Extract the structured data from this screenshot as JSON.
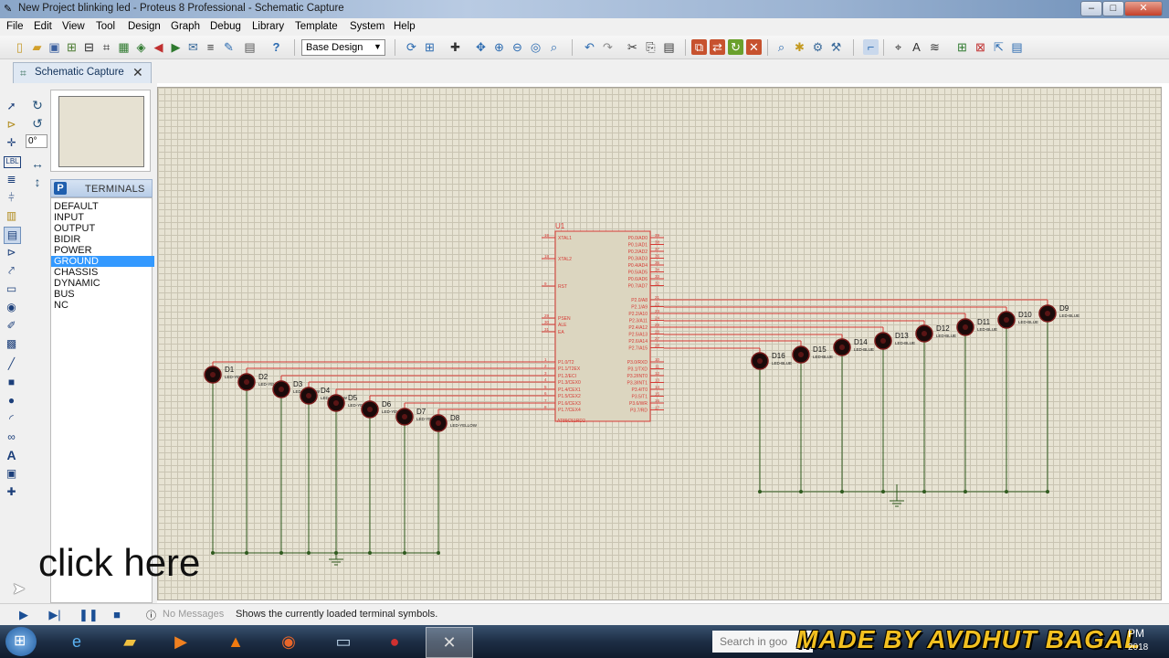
{
  "window": {
    "title": "New Project blinking led - Proteus 8 Professional - Schematic Capture",
    "controls": [
      "–",
      "□",
      "✕"
    ]
  },
  "menu": [
    "File",
    "Edit",
    "View",
    "Tool",
    "Design",
    "Graph",
    "Debug",
    "Library",
    "Template",
    "System",
    "Help"
  ],
  "toolbar": {
    "variant_select": "Base Design"
  },
  "tab": {
    "label": "Schematic Capture"
  },
  "side": {
    "angle": "0°",
    "terminals_title": "TERMINALS",
    "terminals_badge": "P",
    "terminals": [
      "DEFAULT",
      "INPUT",
      "OUTPUT",
      "BIDIR",
      "POWER",
      "GROUND",
      "CHASSIS",
      "DYNAMIC",
      "BUS",
      "NC"
    ],
    "selected_terminal": "GROUND"
  },
  "schematic": {
    "mcu_ref": "U1",
    "mcu_part": "AT89C51RD2",
    "mcu_left_pins": [
      {
        "num": "19",
        "name": "XTAL1"
      },
      {
        "num": "18",
        "name": "XTAL2"
      },
      {
        "num": "9",
        "name": "RST"
      },
      {
        "num": "29",
        "name": "PSEN"
      },
      {
        "num": "30",
        "name": "ALE"
      },
      {
        "num": "31",
        "name": "EA"
      },
      {
        "num": "1",
        "name": "P1.0/T2"
      },
      {
        "num": "2",
        "name": "P1.1/T2EX"
      },
      {
        "num": "3",
        "name": "P1.2/ECI"
      },
      {
        "num": "4",
        "name": "P1.3/CEX0"
      },
      {
        "num": "5",
        "name": "P1.4/CEX1"
      },
      {
        "num": "6",
        "name": "P1.5/CEX2"
      },
      {
        "num": "7",
        "name": "P1.6/CEX3"
      },
      {
        "num": "8",
        "name": "P1.7/CEX4"
      }
    ],
    "mcu_right_pins": [
      {
        "num": "39",
        "name": "P0.0/AD0"
      },
      {
        "num": "38",
        "name": "P0.1/AD1"
      },
      {
        "num": "37",
        "name": "P0.2/AD2"
      },
      {
        "num": "36",
        "name": "P0.3/AD3"
      },
      {
        "num": "35",
        "name": "P0.4/AD4"
      },
      {
        "num": "34",
        "name": "P0.5/AD5"
      },
      {
        "num": "33",
        "name": "P0.6/AD6"
      },
      {
        "num": "32",
        "name": "P0.7/AD7"
      },
      {
        "num": "21",
        "name": "P2.0/A8"
      },
      {
        "num": "22",
        "name": "P2.1/A9"
      },
      {
        "num": "23",
        "name": "P2.2/A10"
      },
      {
        "num": "24",
        "name": "P2.3/A11"
      },
      {
        "num": "25",
        "name": "P2.4/A12"
      },
      {
        "num": "26",
        "name": "P2.5/A13"
      },
      {
        "num": "27",
        "name": "P2.6/A14"
      },
      {
        "num": "28",
        "name": "P2.7/A15"
      },
      {
        "num": "10",
        "name": "P3.0/RXD"
      },
      {
        "num": "11",
        "name": "P3.1/TXD"
      },
      {
        "num": "12",
        "name": "P3.2/INT0"
      },
      {
        "num": "13",
        "name": "P3.3/INT1"
      },
      {
        "num": "14",
        "name": "P3.4/T0"
      },
      {
        "num": "15",
        "name": "P3.5/T1"
      },
      {
        "num": "16",
        "name": "P3.6/WR"
      },
      {
        "num": "17",
        "name": "P3.7/RD"
      }
    ],
    "leds_left": [
      {
        "ref": "D1",
        "type": "LED-YELLOW"
      },
      {
        "ref": "D2",
        "type": "LED-YELLOW"
      },
      {
        "ref": "D3",
        "type": "LED-YELLOW"
      },
      {
        "ref": "D4",
        "type": "LED-YELLOW"
      },
      {
        "ref": "D5",
        "type": "LED-YELLOW"
      },
      {
        "ref": "D6",
        "type": "LED-YELLOW"
      },
      {
        "ref": "D7",
        "type": "LED-YELLOW"
      },
      {
        "ref": "D8",
        "type": "LED-YELLOW"
      }
    ],
    "leds_right": [
      {
        "ref": "D9",
        "type": "LED-BLUE"
      },
      {
        "ref": "D10",
        "type": "LED-BLUE"
      },
      {
        "ref": "D11",
        "type": "LED-BLUE"
      },
      {
        "ref": "D12",
        "type": "LED-BLUE"
      },
      {
        "ref": "D13",
        "type": "LED-BLUE"
      },
      {
        "ref": "D14",
        "type": "LED-BLUE"
      },
      {
        "ref": "D15",
        "type": "LED-BLUE"
      },
      {
        "ref": "D16",
        "type": "LED-BLUE"
      }
    ]
  },
  "overlay": {
    "click_here": "click here"
  },
  "status": {
    "messages": "No Messages",
    "text": "Shows the currently loaded terminal symbols."
  },
  "taskbar": {
    "search_placeholder": "Search in goo",
    "watermark": "MADE BY AVDHUT BAGAL",
    "clock_ampm": "PM",
    "clock_year": "2018"
  },
  "colors": {
    "wire_red": "#d63a34",
    "wire_green": "#2f5a1e",
    "canvas": "#e7e3d3",
    "selection": "#3399ff"
  }
}
